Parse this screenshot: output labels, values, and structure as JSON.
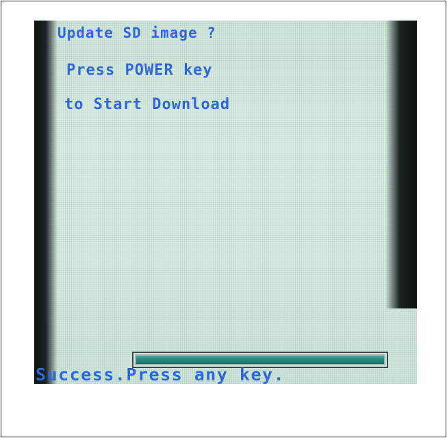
{
  "screen": {
    "lines": [
      "Update SD image ?",
      "Press POWER key",
      "to Start Download"
    ],
    "status_message": "Success.Press any key.",
    "progress_fraction": 1.0
  },
  "colors": {
    "text": "#2f67d8",
    "screen_background": "#d5e9df",
    "progress_fill": "#2b8a80",
    "bezel": "#0f1416"
  }
}
